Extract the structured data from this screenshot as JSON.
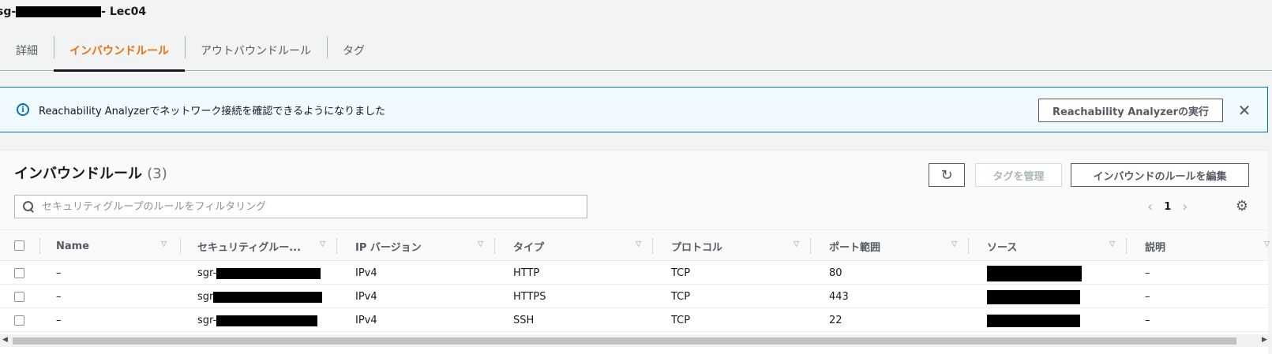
{
  "title": {
    "prefix": "sg-",
    "suffix": " - Lec04"
  },
  "tabs": [
    "詳細",
    "インバウンドルール",
    "アウトバウンドルール",
    "タグ"
  ],
  "banner": {
    "text": "Reachability Analyzerでネットワーク接続を確認できるようになりました",
    "button": "Reachability Analyzerの実行",
    "close": "✕"
  },
  "panel": {
    "title": "インバウンドルール",
    "count": "(3)",
    "manage_tags": "タグを管理",
    "edit_rules": "インバウンドのルールを編集",
    "search_placeholder": "セキュリティグループのルールをフィルタリング",
    "page": "1"
  },
  "columns": [
    "Name",
    "セキュリティグルー...",
    "IP バージョン",
    "タイプ",
    "プロトコル",
    "ポート範囲",
    "ソース",
    "説明"
  ],
  "rows": [
    {
      "name": "–",
      "rule_id": "sgr-",
      "ip": "IPv4",
      "type": "HTTP",
      "protocol": "TCP",
      "port": "80",
      "desc": "–"
    },
    {
      "name": "–",
      "rule_id": "sgr",
      "ip": "IPv4",
      "type": "HTTPS",
      "protocol": "TCP",
      "port": "443",
      "desc": "–"
    },
    {
      "name": "–",
      "rule_id": "sgr-",
      "ip": "IPv4",
      "type": "SSH",
      "protocol": "TCP",
      "port": "22",
      "desc": "–"
    }
  ],
  "icons": {
    "info": "info-icon",
    "refresh": "refresh-icon",
    "search": "search-icon",
    "gear": "gear-icon"
  },
  "colors": {
    "accent": "#ec7211",
    "info": "#0073bb",
    "banner_bg": "#f1faff"
  }
}
